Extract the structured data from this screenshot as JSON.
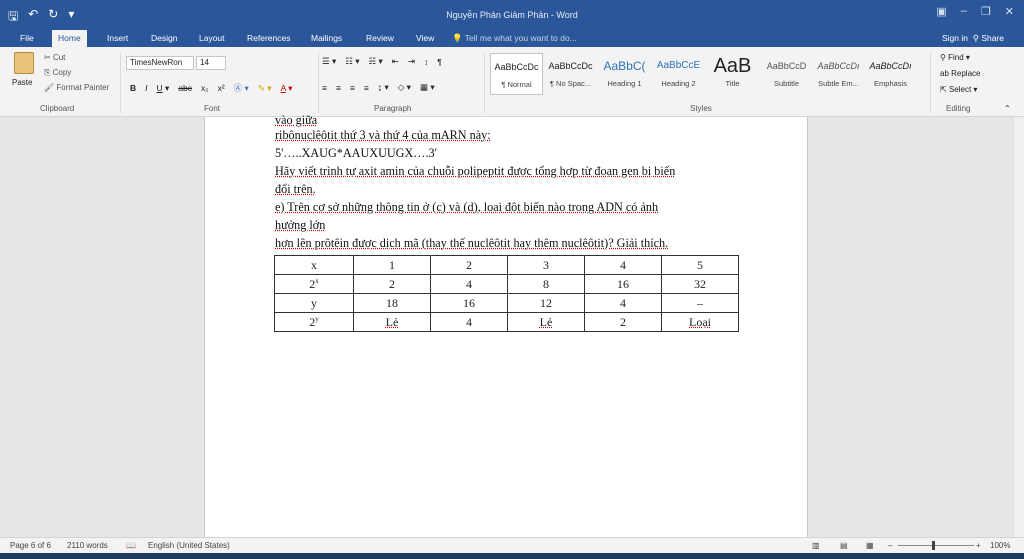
{
  "window": {
    "title": "Nguyễn Phản Giảm Phản - Word"
  },
  "tabs": [
    "File",
    "Home",
    "Insert",
    "Design",
    "Layout",
    "References",
    "Mailings",
    "Review",
    "View"
  ],
  "tell_me": "Tell me what you want to do...",
  "signin": "Sign in",
  "share": "Share",
  "clipboard": {
    "paste": "Paste",
    "cut": "Cut",
    "copy": "Copy",
    "format_painter": "Format Painter",
    "label": "Clipboard"
  },
  "font": {
    "name": "TimesNewRon",
    "size": "14",
    "label": "Font"
  },
  "paragraph": {
    "label": "Paragraph"
  },
  "styles": {
    "label": "Styles",
    "items": [
      {
        "preview": "AaBbCcDc",
        "name": "¶ Normal"
      },
      {
        "preview": "AaBbCcDc",
        "name": "¶ No Spac..."
      },
      {
        "preview": "AaBbC(",
        "name": "Heading 1"
      },
      {
        "preview": "AaBbCcE",
        "name": "Heading 2"
      },
      {
        "preview": "AaB",
        "name": "Title"
      },
      {
        "preview": "AaBbCcD",
        "name": "Subtitle"
      },
      {
        "preview": "AaBbCcDı",
        "name": "Subtle Em..."
      },
      {
        "preview": "AaBbCcDı",
        "name": "Emphasis"
      }
    ]
  },
  "editing": {
    "find": "Find",
    "replace": "Replace",
    "select": "Select",
    "label": "Editing"
  },
  "document": {
    "lines": [
      "vào giữa",
      "ribônuclêôtit thứ 3 và thứ 4 của mARN này:",
      "5'…..XAUG*AAUXUUGX….3'",
      "Hãy viết trình tự axit amin của chuỗi polipeptit được tổng hợp từ đoạn gen bị biến",
      "đổi trên.",
      "e) Trên cơ sở những thông tin ở (c) và (d), loại đột biến nào trong ADN có ảnh",
      "hưởng lớn",
      "hơn lên prôtêin được dịch mã (thay thế nuclêôtit hay thêm nuclêôtit)? Giải thích."
    ],
    "table": {
      "rows": [
        {
          "label": "x",
          "cells": [
            "1",
            "2",
            "3",
            "4",
            "5"
          ]
        },
        {
          "label_base": "2",
          "label_sup": "x",
          "cells": [
            "2",
            "4",
            "8",
            "16",
            "32"
          ]
        },
        {
          "label": "y",
          "cells": [
            "18",
            "16",
            "12",
            "4",
            "–"
          ]
        },
        {
          "label_base": "2",
          "label_sup": "y",
          "cells": [
            "Lẻ",
            "4",
            "Lẻ",
            "2",
            "Loại"
          ]
        }
      ]
    }
  },
  "status": {
    "page": "Page 6 of 6",
    "words": "2110 words",
    "language": "English (United States)",
    "zoom": "100%"
  }
}
